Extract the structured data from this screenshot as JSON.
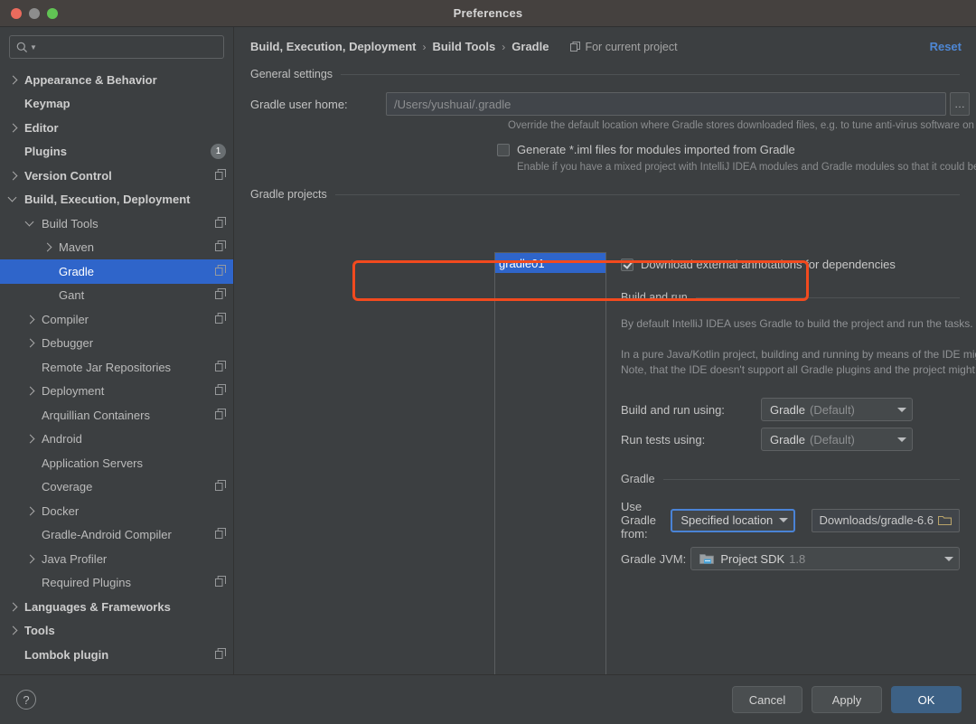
{
  "window": {
    "title": "Preferences"
  },
  "traffic": {
    "close": "close-button",
    "minimize": "minimize-button",
    "zoom": "zoom-button"
  },
  "search": {
    "placeholder": "",
    "value": "",
    "icon": "search-icon"
  },
  "sidebar": {
    "items": [
      {
        "label": "Appearance & Behavior",
        "indent": 0,
        "arrow": "right",
        "bold": true,
        "icon": "",
        "badge": ""
      },
      {
        "label": "Keymap",
        "indent": 0,
        "arrow": "none",
        "bold": true,
        "icon": "",
        "badge": ""
      },
      {
        "label": "Editor",
        "indent": 0,
        "arrow": "right",
        "bold": true,
        "icon": "",
        "badge": ""
      },
      {
        "label": "Plugins",
        "indent": 0,
        "arrow": "none",
        "bold": true,
        "icon": "",
        "badge": "1"
      },
      {
        "label": "Version Control",
        "indent": 0,
        "arrow": "right",
        "bold": true,
        "icon": "copy-icon",
        "badge": ""
      },
      {
        "label": "Build, Execution, Deployment",
        "indent": 0,
        "arrow": "down",
        "bold": true,
        "icon": "",
        "badge": ""
      },
      {
        "label": "Build Tools",
        "indent": 1,
        "arrow": "down",
        "bold": false,
        "icon": "copy-icon",
        "badge": ""
      },
      {
        "label": "Maven",
        "indent": 2,
        "arrow": "right",
        "bold": false,
        "icon": "copy-icon",
        "badge": ""
      },
      {
        "label": "Gradle",
        "indent": 2,
        "arrow": "none",
        "bold": false,
        "icon": "copy-icon",
        "badge": "",
        "selected": true
      },
      {
        "label": "Gant",
        "indent": 2,
        "arrow": "none",
        "bold": false,
        "icon": "copy-icon",
        "badge": ""
      },
      {
        "label": "Compiler",
        "indent": 1,
        "arrow": "right",
        "bold": false,
        "icon": "copy-icon",
        "badge": ""
      },
      {
        "label": "Debugger",
        "indent": 1,
        "arrow": "right",
        "bold": false,
        "icon": "",
        "badge": ""
      },
      {
        "label": "Remote Jar Repositories",
        "indent": 1,
        "arrow": "none",
        "bold": false,
        "icon": "copy-icon",
        "badge": ""
      },
      {
        "label": "Deployment",
        "indent": 1,
        "arrow": "right",
        "bold": false,
        "icon": "copy-icon",
        "badge": ""
      },
      {
        "label": "Arquillian Containers",
        "indent": 1,
        "arrow": "none",
        "bold": false,
        "icon": "copy-icon",
        "badge": ""
      },
      {
        "label": "Android",
        "indent": 1,
        "arrow": "right",
        "bold": false,
        "icon": "",
        "badge": ""
      },
      {
        "label": "Application Servers",
        "indent": 1,
        "arrow": "none",
        "bold": false,
        "icon": "",
        "badge": ""
      },
      {
        "label": "Coverage",
        "indent": 1,
        "arrow": "none",
        "bold": false,
        "icon": "copy-icon",
        "badge": ""
      },
      {
        "label": "Docker",
        "indent": 1,
        "arrow": "right",
        "bold": false,
        "icon": "",
        "badge": ""
      },
      {
        "label": "Gradle-Android Compiler",
        "indent": 1,
        "arrow": "none",
        "bold": false,
        "icon": "copy-icon",
        "badge": ""
      },
      {
        "label": "Java Profiler",
        "indent": 1,
        "arrow": "right",
        "bold": false,
        "icon": "",
        "badge": ""
      },
      {
        "label": "Required Plugins",
        "indent": 1,
        "arrow": "none",
        "bold": false,
        "icon": "copy-icon",
        "badge": ""
      },
      {
        "label": "Languages & Frameworks",
        "indent": 0,
        "arrow": "right",
        "bold": true,
        "icon": "",
        "badge": ""
      },
      {
        "label": "Tools",
        "indent": 0,
        "arrow": "right",
        "bold": true,
        "icon": "",
        "badge": ""
      },
      {
        "label": "Lombok plugin",
        "indent": 0,
        "arrow": "none",
        "bold": true,
        "icon": "copy-icon",
        "badge": ""
      }
    ]
  },
  "header": {
    "breadcrumb": [
      "Build, Execution, Deployment",
      "Build Tools",
      "Gradle"
    ],
    "separator": "›",
    "scope_icon": "copy-icon",
    "scope_label": "For current project",
    "reset_label": "Reset"
  },
  "general": {
    "section_title": "General settings",
    "user_home_label": "Gradle user home:",
    "user_home_placeholder": "/Users/yushuai/.gradle",
    "user_home_value": "",
    "user_home_hint": "Override the default location where Gradle stores downloaded files, e.g. to tune anti-virus software on Windows",
    "browse_button_label": "…",
    "generate_iml_label": "Generate *.iml files for modules imported from Gradle",
    "generate_iml_checked": false,
    "generate_iml_hint": "Enable if you have a mixed project with IntelliJ IDEA modules and Gradle modules so that it could be shared via VCS"
  },
  "projects": {
    "section_title": "Gradle projects",
    "items": [
      {
        "label": "gradle01",
        "selected": true
      }
    ]
  },
  "main": {
    "download_annotations_label": "Download external annotations for dependencies",
    "download_annotations_checked": true,
    "build_run_section": "Build and run",
    "build_run_para1": "By default IntelliJ IDEA uses Gradle to build the project and run the tasks.",
    "build_run_para2_line1": "In a pure Java/Kotlin project, building and running by means of the IDE might be faster, thanks to optimizations.",
    "build_run_para2_line2": "Note, that the IDE doesn't support all Gradle plugins and the project might not be built correctly with some of ther",
    "build_run_using_label": "Build and run using:",
    "build_run_using_value": "Gradle",
    "build_run_using_suffix": "(Default)",
    "run_tests_using_label": "Run tests using:",
    "run_tests_using_value": "Gradle",
    "run_tests_using_suffix": "(Default)",
    "gradle_section": "Gradle",
    "use_gradle_from_label": "Use Gradle from:",
    "use_gradle_from_value": "Specified location",
    "gradle_location_value": "Downloads/gradle-6.6",
    "gradle_location_icon": "folder-icon",
    "gradle_jvm_label": "Gradle JVM:",
    "gradle_jvm_icon": "sdk-folder-icon",
    "gradle_jvm_value": "Project SDK",
    "gradle_jvm_suffix": "1.8"
  },
  "footer": {
    "help_label": "?",
    "cancel_label": "Cancel",
    "apply_label": "Apply",
    "ok_label": "OK"
  },
  "colors": {
    "accent_selection": "#2f65ca",
    "link": "#4e87d4",
    "highlight_box": "#f24a1e",
    "focus_border": "#4a83d6",
    "primary_button": "#3d6185"
  }
}
